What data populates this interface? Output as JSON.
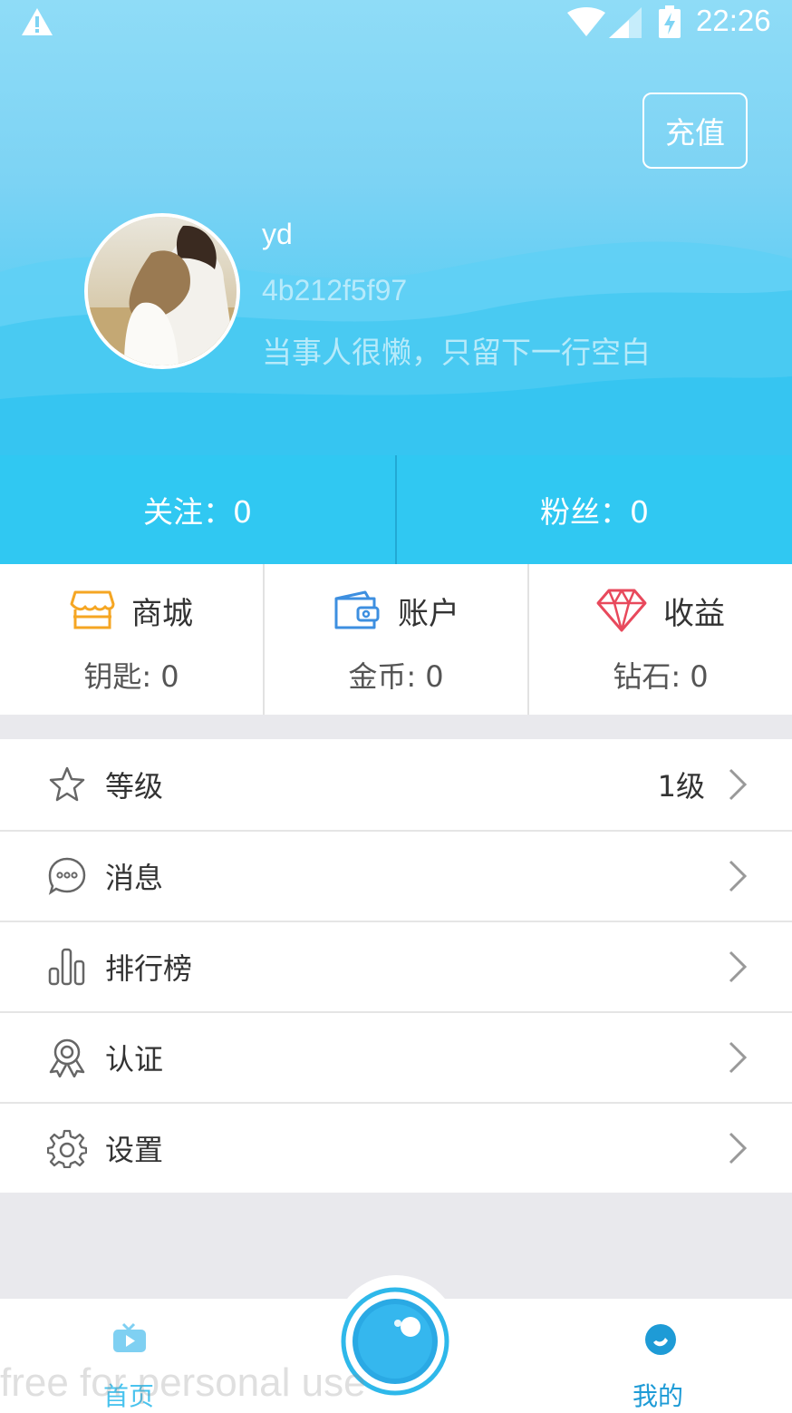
{
  "status_bar": {
    "time": "22:26"
  },
  "header": {
    "recharge_label": "充值",
    "username": "yd",
    "user_id": "4b212f5f97",
    "signature": "当事人很懒，只留下一行空白"
  },
  "follow_bar": {
    "following": "关注：0",
    "fans": "粉丝：0"
  },
  "stats": [
    {
      "title": "商城",
      "value": "钥匙: 0",
      "icon": "store-icon",
      "color": "#f5a623"
    },
    {
      "title": "账户",
      "value": "金币: 0",
      "icon": "wallet-icon",
      "color": "#3d8fe0"
    },
    {
      "title": "收益",
      "value": "钻石: 0",
      "icon": "diamond-icon",
      "color": "#e8495c"
    }
  ],
  "menu": [
    {
      "label": "等级",
      "extra": "1级",
      "icon": "star-icon"
    },
    {
      "label": "消息",
      "extra": "",
      "icon": "message-icon"
    },
    {
      "label": "排行榜",
      "extra": "",
      "icon": "ranking-icon"
    },
    {
      "label": "认证",
      "extra": "",
      "icon": "badge-icon"
    },
    {
      "label": "设置",
      "extra": "",
      "icon": "gear-icon"
    }
  ],
  "bottom_nav": {
    "home_label": "首页",
    "mine_label": "我的"
  },
  "watermark": "free for personal use",
  "colors": {
    "accent": "#30c8f2",
    "active_tab": "#1e9bd6"
  }
}
